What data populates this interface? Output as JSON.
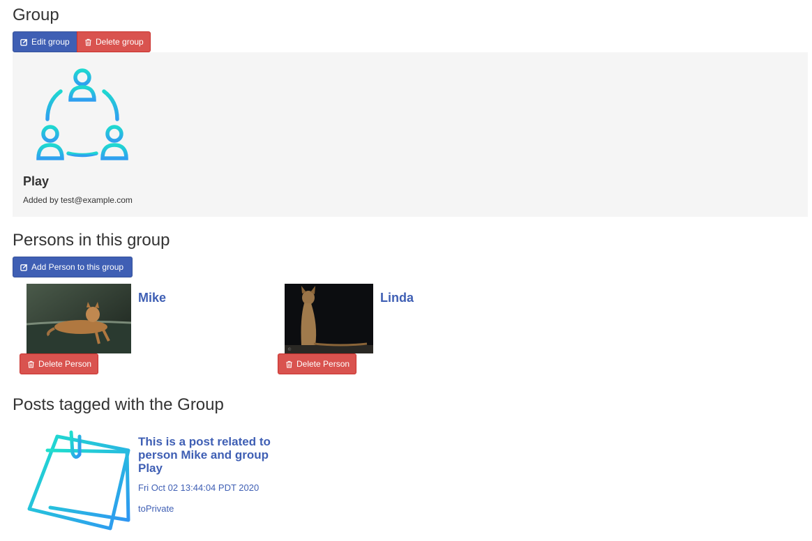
{
  "page": {
    "title": "Group",
    "edit_group_label": "Edit group",
    "delete_group_label": "Delete group"
  },
  "group": {
    "icon": "people-circle-icon",
    "name": "Play",
    "added_by": "Added by test@example.com"
  },
  "persons_section": {
    "heading": "Persons in this group",
    "add_person_label": "Add Person to this group",
    "delete_person_label": "Delete Person",
    "persons": [
      {
        "name": "Mike"
      },
      {
        "name": "Linda"
      }
    ]
  },
  "posts_section": {
    "heading": "Posts tagged with the Group",
    "posts": [
      {
        "icon": "sticky-note-icon",
        "title": "This is a post related to person Mike and group Play",
        "date": "Fri Oct 02 13:44:04 PDT 2020",
        "visibility": "toPrivate"
      }
    ]
  },
  "colors": {
    "primary": "#3f5fb4",
    "danger": "#d9534f",
    "well": "#f5f5f5",
    "icon_gradient_start": "#1fd8d0",
    "icon_gradient_end": "#2f9ff0"
  }
}
